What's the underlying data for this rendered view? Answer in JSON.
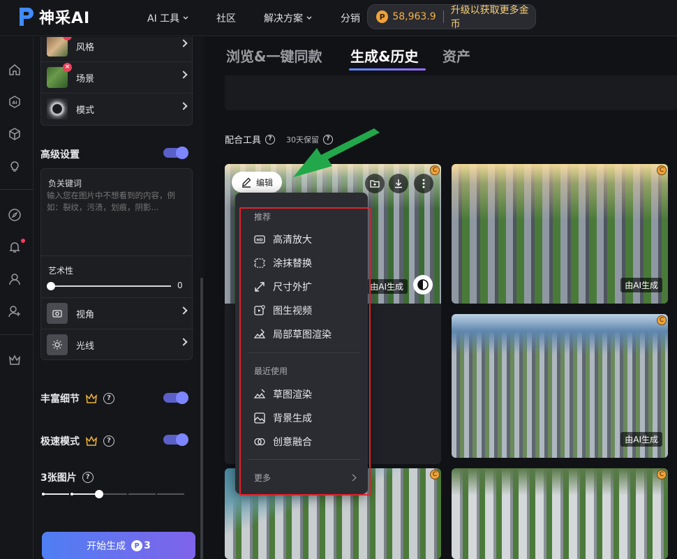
{
  "app": {
    "brand": "神采AI"
  },
  "nav": [
    {
      "label": "AI 工具",
      "has_dropdown": true
    },
    {
      "label": "社区",
      "has_dropdown": false
    },
    {
      "label": "解决方案",
      "has_dropdown": true
    },
    {
      "label": "分销",
      "has_dropdown": false
    }
  ],
  "coins": {
    "balance": "58,963.9",
    "upgrade_label": "升级以获取更多金币"
  },
  "sidebar_icons": [
    "home-icon",
    "ai-icon",
    "cube-icon",
    "bulb-icon",
    "compass-icon",
    "bell-icon",
    "user-icon",
    "user-add-icon",
    "crown-icon"
  ],
  "panel": {
    "style_rows": [
      {
        "label": "风格",
        "icon": "style-thumb",
        "has_remove_badge": true
      },
      {
        "label": "场景",
        "icon": "scene-thumb",
        "has_remove_badge": true
      },
      {
        "label": "模式",
        "icon": "mode-thumb",
        "has_remove_badge": false
      }
    ],
    "advanced": {
      "label": "高级设置",
      "enabled": true
    },
    "negative": {
      "title": "负关键词",
      "placeholder": "输入您在图片中不想看到的内容，例如：裂纹，污渍，划痕，阴影..."
    },
    "artistry": {
      "label": "艺术性",
      "value": "0"
    },
    "angle_rows": [
      {
        "label": "视角",
        "icon": "camera-angle-icon"
      },
      {
        "label": "光线",
        "icon": "sun-icon"
      }
    ],
    "rich_detail": {
      "label": "丰富细节",
      "enabled": true
    },
    "fast_mode": {
      "label": "极速模式",
      "enabled": true
    },
    "image_count": {
      "label": "3张图片",
      "steps": 5,
      "selected_step": 2
    },
    "generate": {
      "label": "开始生成",
      "cost": "3"
    }
  },
  "main": {
    "tabs": [
      {
        "label": "浏览&一键同款",
        "active": false
      },
      {
        "label": "生成&历史",
        "active": true
      },
      {
        "label": "资产",
        "active": false
      }
    ],
    "tools_label": "配合工具",
    "retention_label": "30天保留",
    "ai_tag": "由AI生成",
    "edit_label": "编辑",
    "coin_corner_icon": "c-coin-icon"
  },
  "menu": {
    "recommended_title": "推荐",
    "recommended": [
      {
        "label": "高清放大",
        "icon": "hd-icon"
      },
      {
        "label": "涂抹替换",
        "icon": "brush-replace-icon"
      },
      {
        "label": "尺寸外扩",
        "icon": "expand-icon"
      },
      {
        "label": "图生视频",
        "icon": "image-video-icon"
      },
      {
        "label": "局部草图渲染",
        "icon": "partial-sketch-icon"
      }
    ],
    "recent_title": "最近使用",
    "recent": [
      {
        "label": "草图渲染",
        "icon": "sketch-render-icon"
      },
      {
        "label": "背景生成",
        "icon": "background-icon"
      },
      {
        "label": "创意融合",
        "icon": "fusion-icon"
      }
    ],
    "more_label": "更多"
  },
  "colors": {
    "accent": "#5a60c8",
    "highlight": "#e0232b",
    "arrow": "#22a84a",
    "coin": "#f0a23a"
  }
}
